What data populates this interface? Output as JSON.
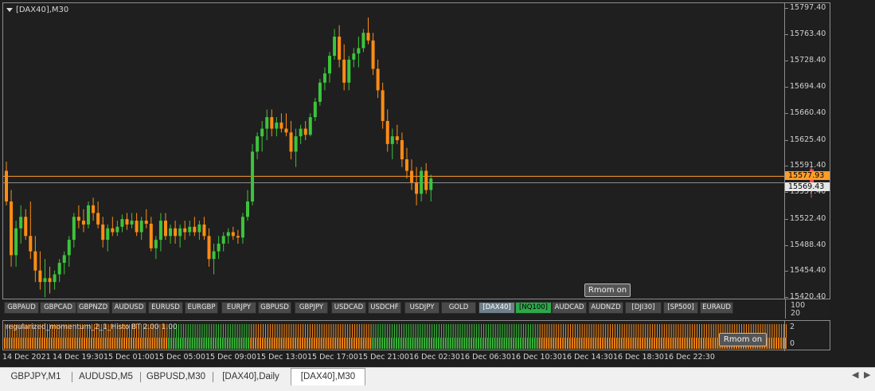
{
  "chart": {
    "title": "[DAX40],M30",
    "current_price_label": "15577.93",
    "bid_label": "15569.43",
    "price_line_value": 15577.93,
    "bid_line_value": 15569.43,
    "y_labels": [
      "15797.40",
      "15763.40",
      "15728.40",
      "15694.40",
      "15660.40",
      "15625.40",
      "15591.40",
      "15557.40",
      "15522.40",
      "15488.40",
      "15454.40",
      "15420.40"
    ],
    "y_min": 15420.4,
    "y_max": 15797.4,
    "rmom_button": "Rmom on",
    "colors": {
      "bull": "#3cc43c",
      "bear": "#ff8c14",
      "price_line": "#ff9c28",
      "bid_line": "#8c8c8c",
      "last_candle": "#ff5050"
    },
    "candles": [
      [
        15585,
        15597,
        15540,
        15545
      ],
      [
        15545,
        15560,
        15460,
        15475
      ],
      [
        15475,
        15520,
        15460,
        15510
      ],
      [
        15510,
        15540,
        15490,
        15525
      ],
      [
        15525,
        15535,
        15495,
        15500
      ],
      [
        15500,
        15545,
        15470,
        15480
      ],
      [
        15480,
        15500,
        15440,
        15455
      ],
      [
        15455,
        15480,
        15430,
        15440
      ],
      [
        15440,
        15470,
        15420,
        15445
      ],
      [
        15445,
        15460,
        15425,
        15440
      ],
      [
        15440,
        15455,
        15430,
        15450
      ],
      [
        15450,
        15470,
        15440,
        15465
      ],
      [
        15465,
        15480,
        15450,
        15475
      ],
      [
        15475,
        15500,
        15460,
        15495
      ],
      [
        15495,
        15530,
        15485,
        15525
      ],
      [
        15525,
        15540,
        15510,
        15520
      ],
      [
        15520,
        15535,
        15505,
        15515
      ],
      [
        15515,
        15545,
        15510,
        15540
      ],
      [
        15540,
        15550,
        15520,
        15530
      ],
      [
        15530,
        15545,
        15510,
        15515
      ],
      [
        15515,
        15525,
        15485,
        15495
      ],
      [
        15495,
        15515,
        15480,
        15510
      ],
      [
        15510,
        15525,
        15500,
        15505
      ],
      [
        15505,
        15520,
        15500,
        15512
      ],
      [
        15512,
        15528,
        15505,
        15522
      ],
      [
        15522,
        15530,
        15508,
        15515
      ],
      [
        15515,
        15530,
        15510,
        15520
      ],
      [
        15520,
        15530,
        15500,
        15505
      ],
      [
        15505,
        15525,
        15495,
        15520
      ],
      [
        15520,
        15535,
        15510,
        15516
      ],
      [
        15516,
        15525,
        15480,
        15484
      ],
      [
        15484,
        15500,
        15470,
        15495
      ],
      [
        15495,
        15530,
        15480,
        15520
      ],
      [
        15520,
        15530,
        15495,
        15500
      ],
      [
        15500,
        15515,
        15490,
        15510
      ],
      [
        15510,
        15520,
        15490,
        15500
      ],
      [
        15500,
        15515,
        15485,
        15510
      ],
      [
        15510,
        15520,
        15495,
        15505
      ],
      [
        15505,
        15520,
        15500,
        15512
      ],
      [
        15512,
        15525,
        15500,
        15505
      ],
      [
        15505,
        15520,
        15495,
        15515
      ],
      [
        15515,
        15525,
        15495,
        15500
      ],
      [
        15500,
        15510,
        15460,
        15470
      ],
      [
        15470,
        15490,
        15450,
        15480
      ],
      [
        15480,
        15500,
        15470,
        15490
      ],
      [
        15490,
        15505,
        15480,
        15500
      ],
      [
        15500,
        15510,
        15490,
        15505
      ],
      [
        15505,
        15512,
        15495,
        15500
      ],
      [
        15500,
        15508,
        15490,
        15498
      ],
      [
        15498,
        15530,
        15490,
        15525
      ],
      [
        15525,
        15560,
        15520,
        15545
      ],
      [
        15545,
        15620,
        15540,
        15610
      ],
      [
        15610,
        15635,
        15600,
        15630
      ],
      [
        15630,
        15650,
        15610,
        15640
      ],
      [
        15640,
        15665,
        15625,
        15655
      ],
      [
        15655,
        15665,
        15630,
        15640
      ],
      [
        15640,
        15655,
        15630,
        15648
      ],
      [
        15648,
        15660,
        15635,
        15640
      ],
      [
        15640,
        15660,
        15630,
        15635
      ],
      [
        15635,
        15650,
        15600,
        15610
      ],
      [
        15610,
        15640,
        15590,
        15630
      ],
      [
        15630,
        15645,
        15620,
        15640
      ],
      [
        15640,
        15650,
        15625,
        15632
      ],
      [
        15632,
        15660,
        15630,
        15655
      ],
      [
        15655,
        15680,
        15650,
        15675
      ],
      [
        15675,
        15705,
        15670,
        15700
      ],
      [
        15700,
        15720,
        15690,
        15712
      ],
      [
        15712,
        15740,
        15700,
        15735
      ],
      [
        15735,
        15770,
        15730,
        15760
      ],
      [
        15760,
        15775,
        15720,
        15730
      ],
      [
        15730,
        15750,
        15690,
        15700
      ],
      [
        15700,
        15735,
        15690,
        15730
      ],
      [
        15730,
        15745,
        15720,
        15738
      ],
      [
        15738,
        15760,
        15720,
        15745
      ],
      [
        15745,
        15770,
        15740,
        15765
      ],
      [
        15765,
        15785,
        15750,
        15755
      ],
      [
        15755,
        15765,
        15710,
        15718
      ],
      [
        15718,
        15730,
        15680,
        15690
      ],
      [
        15690,
        15700,
        15640,
        15650
      ],
      [
        15650,
        15665,
        15610,
        15620
      ],
      [
        15620,
        15640,
        15600,
        15630
      ],
      [
        15630,
        15645,
        15620,
        15625
      ],
      [
        15625,
        15635,
        15590,
        15600
      ],
      [
        15600,
        15615,
        15575,
        15585
      ],
      [
        15585,
        15600,
        15560,
        15570
      ],
      [
        15570,
        15590,
        15540,
        15555
      ],
      [
        15555,
        15590,
        15545,
        15585
      ],
      [
        15585,
        15595,
        15555,
        15560
      ],
      [
        15560,
        15580,
        15545,
        15575
      ]
    ],
    "last_candle": [
      15587,
      15590,
      15550,
      15569
    ]
  },
  "symbols": [
    "GBPAUD",
    "GBPCAD",
    "GBPNZD",
    "AUDUSD",
    "EURUSD",
    "EURGBP",
    "EURJPY",
    "GBPUSD",
    "GBPJPY",
    "USDCAD",
    "USDCHF",
    "USDJPY",
    "GOLD",
    "[DAX40]",
    "[NQ100]",
    "AUDCAD",
    "AUDNZD",
    "[DJI30]",
    "[SP500]",
    "EURAUD"
  ],
  "symbol_states": {
    "[DAX40]": "selected",
    "[NQ100]": "highlight"
  },
  "symbol_axis": [
    "100",
    "20"
  ],
  "indicator": {
    "title": "regularized_momentum_2_1_Histo BT 2.00 1.00",
    "y_labels": [
      "2",
      "0"
    ],
    "rmom_button": "Rmom on",
    "bars": "OOOOOOOOOOOOOOOOOOOOOOOOOOOOOOOOOOOOOOOOOOOOOOOOOOOOOOOOOOOOOOOOOOOOOOGGGGGGGGGGGGGGGGGGGGGGGGGGGGGGGGGGGOOOOOOOOOOOOOOOOOOOOOOOOOOOOOOOOOOOOOOOOOOOOOOOOOOOOGGGGGGGGGGGGGGGGGGGGGGGGGGGGGGGGGGGGGGGGGGGGGGGGGGGGGGGGGGGGGGGGGGGGGGGOOOOOOOOOOOOOOOOOOOOOOOOOOOOOOOOOOOOOOOOOOOOOOOOOOOOOOOOOOOOOOOOOOOOOOOOOOOOOOOOOOOOOOOOOOOOOOOOOOOOOOOOOO"
  },
  "x_labels": [
    "14 Dec 2021",
    "14 Dec 19:30",
    "15 Dec 01:00",
    "15 Dec 05:00",
    "15 Dec 09:00",
    "15 Dec 13:00",
    "15 Dec 17:00",
    "15 Dec 21:00",
    "16 Dec 02:30",
    "16 Dec 06:30",
    "16 Dec 10:30",
    "16 Dec 14:30",
    "16 Dec 18:30",
    "16 Dec 22:30"
  ],
  "tabs": [
    "GBPJPY,M1",
    "AUDUSD,M5",
    "GBPUSD,M30",
    "[DAX40],Daily",
    "[DAX40],M30"
  ],
  "active_tab": "[DAX40],M30"
}
